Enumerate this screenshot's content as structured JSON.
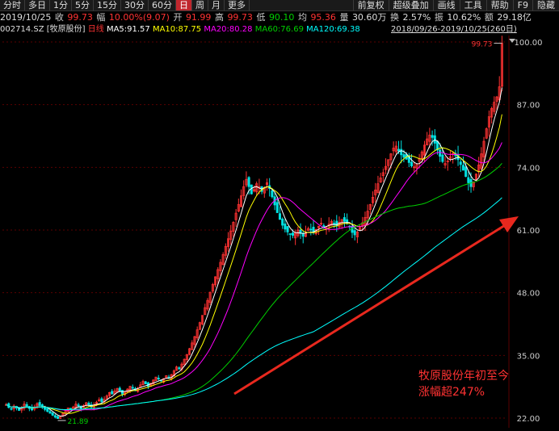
{
  "toolbar": {
    "periods": [
      "分时",
      "多日",
      "1分",
      "5分",
      "15分",
      "30分",
      "60分",
      "日",
      "周",
      "月",
      "更多"
    ],
    "active": "日",
    "right": [
      "前复权",
      "超级叠加",
      "画线",
      "工具",
      "帮助",
      "F9",
      "隐藏"
    ]
  },
  "quote": {
    "date": "2019/10/25",
    "close_label": "收",
    "close": "99.73",
    "change_label": "幅",
    "change": "10.00%(9.07)",
    "open_label": "开",
    "open": "91.99",
    "high_label": "高",
    "high": "99.73",
    "low_label": "低",
    "low": "90.10",
    "avg_label": "均",
    "avg": "95.36",
    "volume_label": "量",
    "volume": "30.60万",
    "turnover_label": "换",
    "turnover": "2.57%",
    "amplitude_label": "振",
    "amplitude": "10.62%",
    "amount_label": "额",
    "amount": "29.18亿"
  },
  "ma_bar": {
    "code": "002714.SZ",
    "name": "[牧原股份]",
    "period": "日线",
    "ma5": "MA5:91.57",
    "ma10": "MA10:87.75",
    "ma20": "MA20:80.28",
    "ma60": "MA60:76.69",
    "ma120": "MA120:69.38",
    "range": "2018/09/26-2019/10/25(260日)"
  },
  "annotation": {
    "line1": "牧原股份年初至今",
    "line2": "涨幅超247%"
  },
  "colors": {
    "up": "#ff3232",
    "down": "#00e0e0",
    "ma5": "#ffffff",
    "ma10": "#ffff00",
    "ma20": "#ff00ff",
    "ma60": "#00d000",
    "ma120": "#00ffff",
    "grid": "#5a0000",
    "arrow": "#e8281e"
  },
  "chart_data": {
    "type": "candlestick",
    "ylim": [
      22,
      100
    ],
    "yticks": [
      "100.00",
      "87.00",
      "74.00",
      "61.00",
      "48.00",
      "35.00",
      "22.00"
    ],
    "high_label": "99.73",
    "low_label": "21.89",
    "closes": [
      24.8,
      24.2,
      23.9,
      24.5,
      24.1,
      23.6,
      24.2,
      24.9,
      24.4,
      24.0,
      23.7,
      24.3,
      25.0,
      24.6,
      24.2,
      23.8,
      23.4,
      23.0,
      22.6,
      22.2,
      21.9,
      22.4,
      23.0,
      23.5,
      24.1,
      23.8,
      24.3,
      24.9,
      24.5,
      24.0,
      24.6,
      25.2,
      24.8,
      24.3,
      24.7,
      25.3,
      25.8,
      25.4,
      25.9,
      26.6,
      27.3,
      27.0,
      27.6,
      28.1,
      27.6,
      27.0,
      27.4,
      28.0,
      28.6,
      28.2,
      27.7,
      28.2,
      28.9,
      29.6,
      29.1,
      28.6,
      29.2,
      29.9,
      30.5,
      30.1,
      29.7,
      30.2,
      30.8,
      30.4,
      31.0,
      31.8,
      32.6,
      32.2,
      33.2,
      34.2,
      35.2,
      36.4,
      37.6,
      38.9,
      40.3,
      41.8,
      43.3,
      44.9,
      46.4,
      48.1,
      49.7,
      51.3,
      52.8,
      54.3,
      55.9,
      57.6,
      59.2,
      60.8,
      62.6,
      64.5,
      66.3,
      68.1,
      70.0,
      71.5,
      70.0,
      68.5,
      69.4,
      70.6,
      70.0,
      69.0,
      69.8,
      70.8,
      69.6,
      67.9,
      66.2,
      64.6,
      63.2,
      62.0,
      61.2,
      60.6,
      60.2,
      59.9,
      60.4,
      61.0,
      60.3,
      59.7,
      60.4,
      61.3,
      61.0,
      60.5,
      61.1,
      61.8,
      62.4,
      61.9,
      61.5,
      62.2,
      62.8,
      62.3,
      61.9,
      62.6,
      63.2,
      62.8,
      62.4,
      61.7,
      60.5,
      60.0,
      60.6,
      61.5,
      62.5,
      63.6,
      64.9,
      66.3,
      67.8,
      69.3,
      70.6,
      71.8,
      72.9,
      74.2,
      75.6,
      76.8,
      78.0,
      78.4,
      77.4,
      76.6,
      76.1,
      75.7,
      75.0,
      74.3,
      74.1,
      74.6,
      75.8,
      77.2,
      78.6,
      79.9,
      80.7,
      80.2,
      79.0,
      77.6,
      76.3,
      75.2,
      74.8,
      75.3,
      76.2,
      76.9,
      76.4,
      75.6,
      74.6,
      73.4,
      72.1,
      70.8,
      70.0,
      71.0,
      72.6,
      74.5,
      76.8,
      79.4,
      82.0,
      84.5,
      86.2,
      87.5,
      88.6,
      90.7,
      99.73
    ],
    "series": [
      {
        "name": "MA5"
      },
      {
        "name": "MA10"
      },
      {
        "name": "MA20"
      },
      {
        "name": "MA60"
      },
      {
        "name": "MA120"
      }
    ]
  }
}
